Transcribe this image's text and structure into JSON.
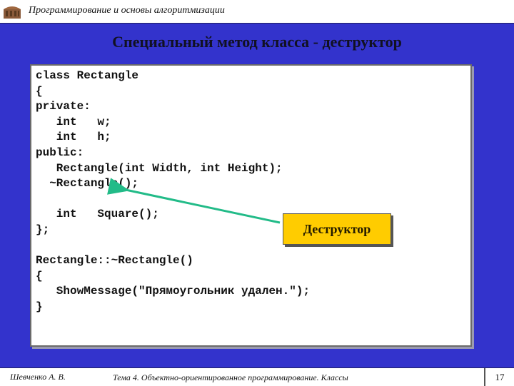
{
  "header": {
    "course_title": "Программирование и основы алгоритмизации",
    "logo_icon": "building-logo-icon"
  },
  "slide": {
    "title": "Специальный метод класса - деструктор",
    "code_lines": [
      "class Rectangle",
      "{",
      "private:",
      "   int   w;",
      "   int   h;",
      "public:",
      "   Rectangle(int Width, int Height);",
      "  ~Rectangle();",
      "",
      "   int   Square();",
      "};",
      "",
      "Rectangle::~Rectangle()",
      "{",
      "   ShowMessage(\"Прямоугольник удален.\");",
      "}"
    ],
    "callout_label": "Деструктор",
    "colors": {
      "background": "#3333cc",
      "callout": "#ffcc00",
      "arrow": "#22bb88"
    }
  },
  "footer": {
    "author": "Шевченко А. В.",
    "topic": "Тема 4. Объектно-ориентированное программирование. Классы",
    "page_number": "17"
  }
}
